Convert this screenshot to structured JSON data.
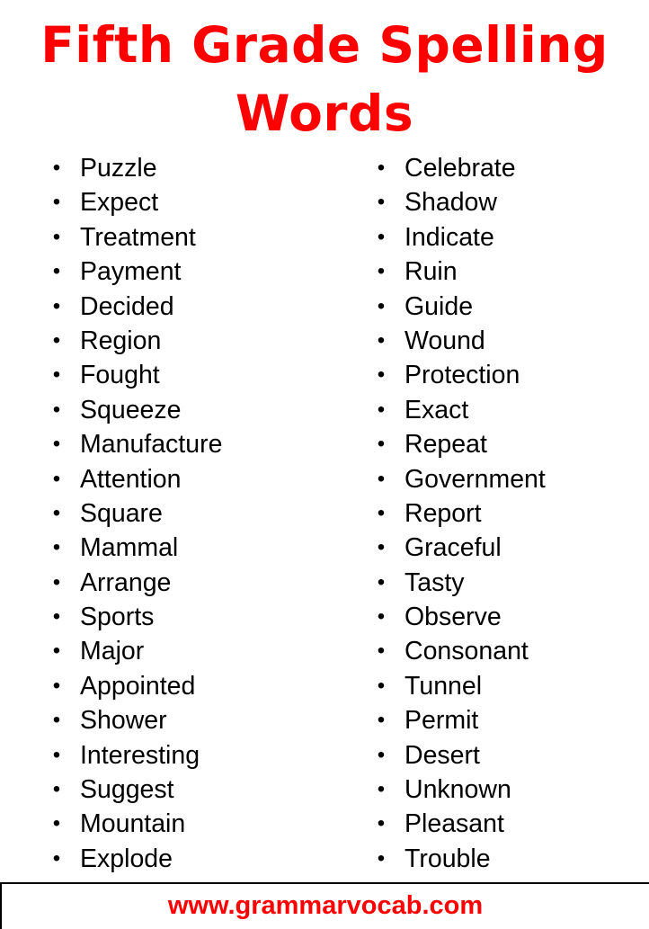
{
  "title": {
    "line1": "Fifth Grade Spelling",
    "line2": "Words"
  },
  "bullet_glyph": "•",
  "columns": {
    "left": [
      "Puzzle",
      "Expect",
      "Treatment",
      "Payment",
      "Decided",
      "Region",
      "Fought",
      "Squeeze",
      "Manufacture",
      "Attention",
      "Square",
      "Mammal",
      "Arrange",
      "Sports",
      "Major",
      "Appointed",
      "Shower",
      "Interesting",
      "Suggest",
      "Mountain",
      "Explode"
    ],
    "right": [
      "Celebrate",
      "Shadow",
      "Indicate",
      "Ruin",
      "Guide",
      "Wound",
      "Protection",
      "Exact",
      "Repeat",
      "Government",
      "Report",
      "Graceful",
      "Tasty",
      "Observe",
      "Consonant",
      "Tunnel",
      "Permit",
      "Desert",
      "Unknown",
      "Pleasant",
      "Trouble"
    ]
  },
  "footer": {
    "website": "www.grammarvocab.com"
  },
  "colors": {
    "accent": "#ff0000",
    "text": "#000000",
    "background": "#ffffff"
  }
}
